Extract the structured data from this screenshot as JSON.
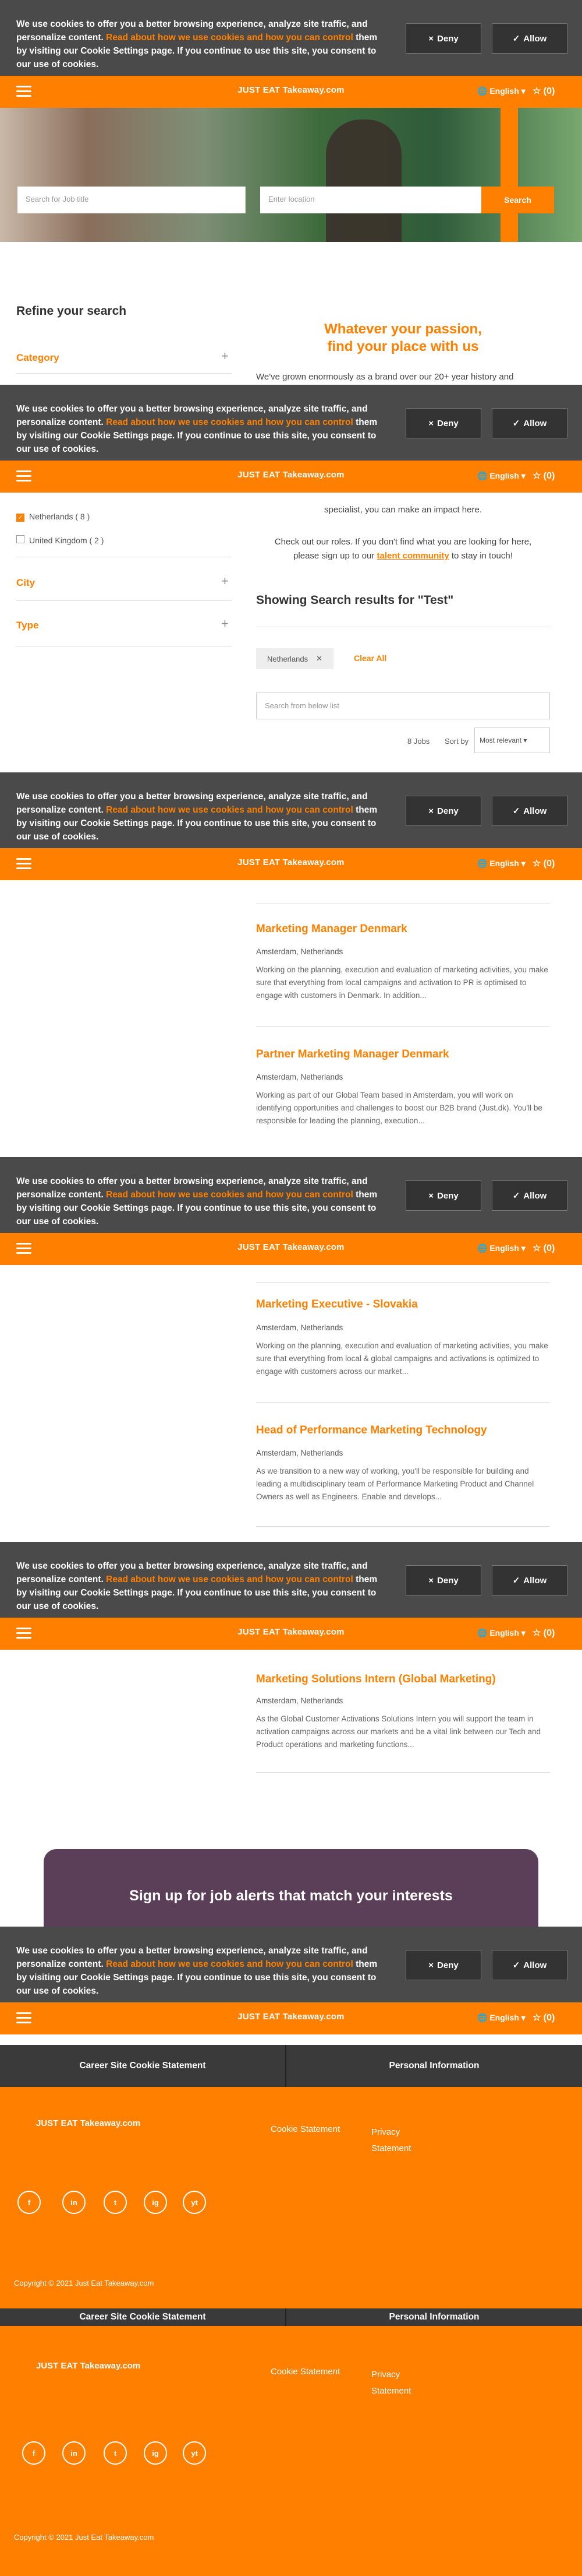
{
  "cookie": {
    "text_before": "We use cookies to offer you a better browsing experience, analyze site traffic, and personalize content. ",
    "link": "Read about how we use cookies and how you can control",
    "text_after": " them by visiting our Cookie Settings page. If you continue to use this site, you consent to our use of cookies.",
    "deny": "Deny",
    "allow": "Allow"
  },
  "header": {
    "logo": "JUST EAT Takeaway.com",
    "language": "English",
    "favorites": "(0)"
  },
  "hero": {
    "job_title_placeholder": "Search for Job title",
    "location_placeholder": "Enter location",
    "search_button": "Search"
  },
  "sidebar": {
    "title": "Refine your search",
    "category": "Category",
    "country_options": [
      "Netherlands ( 8 )",
      "United Kingdom ( 2 )"
    ],
    "city": "City",
    "type": "Type"
  },
  "intro": {
    "headline_1": "Whatever your passion,",
    "headline_2": "find your place with us",
    "para_1": "We've grown enormously as a brand over our 20+ year history and",
    "para_2": "specialist, you can make an impact here.",
    "cta_1": "Check out our roles. If you don't find what you are looking for here,",
    "cta_2_before": "please sign up to our ",
    "cta_link": "talent community",
    "cta_2_after": " to stay in touch!"
  },
  "results": {
    "heading": "Showing Search results for \"Test\"",
    "chip": "Netherlands",
    "clear_all": "Clear All",
    "search_placeholder": "Search from below list",
    "count": "8 Jobs",
    "sort_label": "Sort by",
    "sort_value": "Most relevant"
  },
  "jobs": [
    {
      "title": "Marketing Manager Denmark",
      "location": "Amsterdam, Netherlands",
      "desc": "Working on the planning, execution and evaluation of marketing activities, you make sure that everything from local campaigns and activation to PR is optimised to engage with customers in Denmark. In addition..."
    },
    {
      "title": "Partner Marketing Manager Denmark",
      "location": "Amsterdam, Netherlands",
      "desc": "Working as part of our Global Team based in Amsterdam, you will work on identifying opportunities and challenges to boost our B2B brand (Just.dk). You'll be responsible for leading the planning, execution..."
    },
    {
      "title": "Marketing Executive - Slovakia",
      "location": "Amsterdam, Netherlands",
      "desc": "Working on the planning, execution and evaluation of marketing activities, you make sure that everything from local & global campaigns and activations is optimized to engage with customers across our market..."
    },
    {
      "title": "Head of Performance Marketing Technology",
      "location": "Amsterdam, Netherlands",
      "desc": "As we transition to a new way of working, you'll be responsible for building and leading a multidisciplinary team of Performance Marketing Product and Channel Owners as well as Engineers. Enable and develops..."
    },
    {
      "title": "Marketing Solutions Intern (Global Marketing)",
      "location": "Amsterdam, Netherlands",
      "desc": "As the Global Customer Activations Solutions Intern you will support the team in activation campaigns across our markets and be a vital link between our Tech and Product operations and marketing functions..."
    }
  ],
  "alerts": {
    "heading": "Sign up for job alerts that match your interests"
  },
  "footer": {
    "col1": "Career Site Cookie Statement",
    "col2": "Personal Information",
    "logo": "JUST EAT Takeaway.com",
    "link1": "Cookie Statement",
    "link2a": "Privacy",
    "link2b": "Statement",
    "social": [
      "f",
      "in",
      "t",
      "ig",
      "yt"
    ],
    "copyright": "Copyright © 2021 Just Eat Takeaway.com"
  }
}
